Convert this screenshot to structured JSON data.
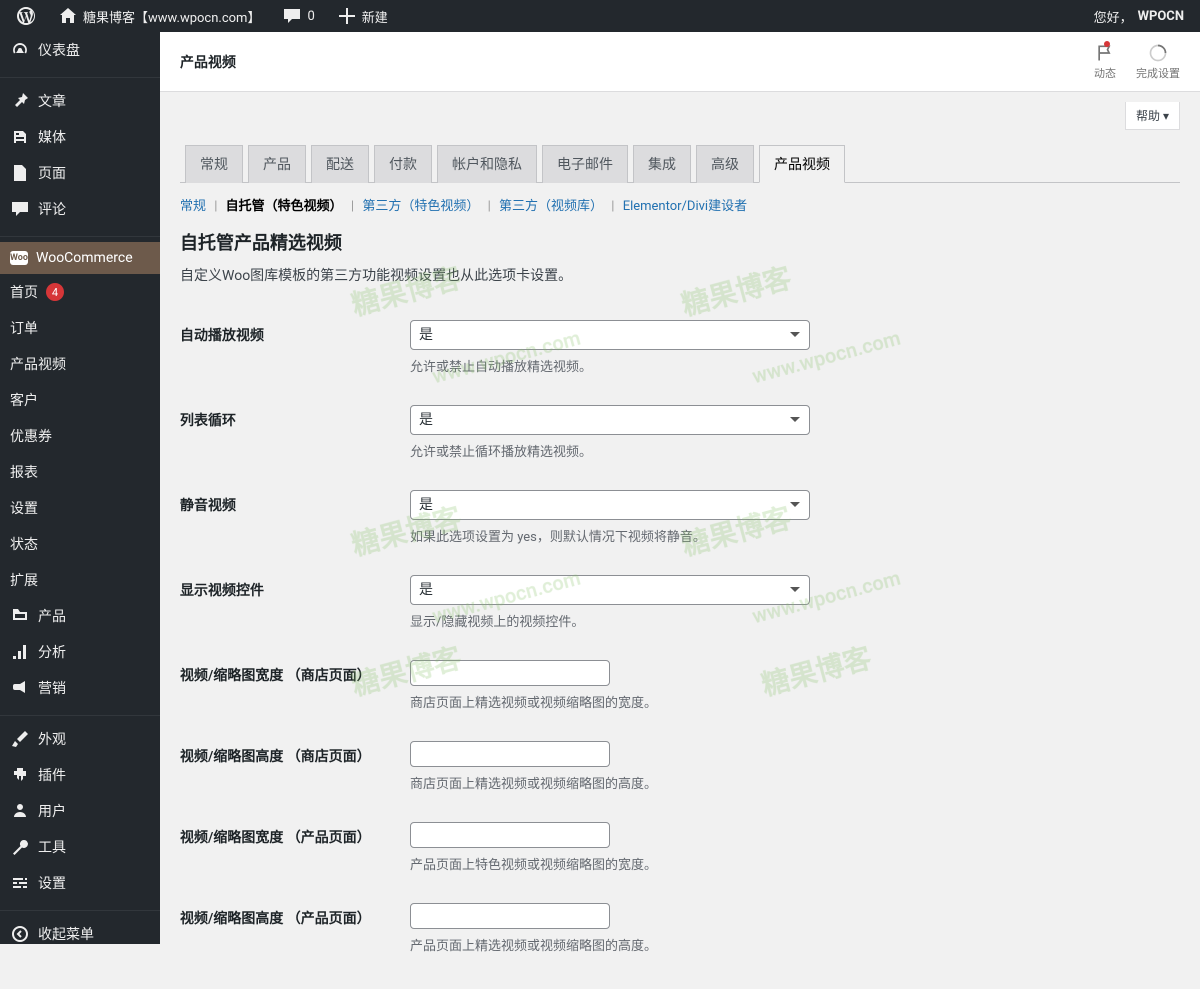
{
  "adminbar": {
    "site_name": "糖果博客【www.wpocn.com】",
    "comments_count": "0",
    "add_new": "新建",
    "howdy_prefix": "您好，",
    "username": "WPOCN"
  },
  "sidebar": {
    "items": [
      {
        "label": "仪表盘",
        "icon": "dashboard"
      },
      {
        "label": "文章",
        "icon": "post"
      },
      {
        "label": "媒体",
        "icon": "media"
      },
      {
        "label": "页面",
        "icon": "page"
      },
      {
        "label": "评论",
        "icon": "comment"
      },
      {
        "label": "WooCommerce",
        "icon": "woo",
        "current": true
      },
      {
        "label": "产品",
        "icon": "product"
      },
      {
        "label": "分析",
        "icon": "analytics"
      },
      {
        "label": "营销",
        "icon": "marketing"
      },
      {
        "label": "外观",
        "icon": "appearance"
      },
      {
        "label": "插件",
        "icon": "plugin"
      },
      {
        "label": "用户",
        "icon": "user"
      },
      {
        "label": "工具",
        "icon": "tool"
      },
      {
        "label": "设置",
        "icon": "settings"
      },
      {
        "label": "收起菜单",
        "icon": "collapse"
      }
    ],
    "woo_submenu": [
      {
        "label": "首页",
        "badge": "4"
      },
      {
        "label": "订单"
      },
      {
        "label": "产品视频"
      },
      {
        "label": "客户"
      },
      {
        "label": "优惠券"
      },
      {
        "label": "报表"
      },
      {
        "label": "设置",
        "current": true
      },
      {
        "label": "状态"
      },
      {
        "label": "扩展"
      }
    ]
  },
  "header": {
    "title": "产品视频",
    "activity": "动态",
    "finish_setup": "完成设置"
  },
  "help_label": "帮助",
  "tabs": [
    "常规",
    "产品",
    "配送",
    "付款",
    "帐户和隐私",
    "电子邮件",
    "集成",
    "高级",
    "产品视频"
  ],
  "active_tab_index": 8,
  "subtabs": {
    "general": "常规",
    "self_hosted": "自托管（特色视频）",
    "third_party_featured": "第三方（特色视频）",
    "third_party_library": "第三方（视频库）",
    "elementor": "Elementor/Divi建设者"
  },
  "section": {
    "title": "自托管产品精选视频",
    "description": "自定义Woo图库模板的第三方功能视频设置也从此选项卡设置。"
  },
  "fields": [
    {
      "label": "自动播放视频",
      "type": "select",
      "value": "是",
      "desc": "允许或禁止自动播放精选视频。"
    },
    {
      "label": "列表循环",
      "type": "select",
      "value": "是",
      "desc": "允许或禁止循环播放精选视频。"
    },
    {
      "label": "静音视频",
      "type": "select",
      "value": "是",
      "desc": "如果此选项设置为 yes，则默认情况下视频将静音。"
    },
    {
      "label": "显示视频控件",
      "type": "select",
      "value": "是",
      "desc": "显示/隐藏视频上的视频控件。"
    },
    {
      "label": "视频/缩略图宽度 （商店页面）",
      "type": "text",
      "value": "",
      "desc": "商店页面上精选视频或视频缩略图的宽度。"
    },
    {
      "label": "视频/缩略图高度 （商店页面）",
      "type": "text",
      "value": "",
      "desc": "商店页面上精选视频或视频缩略图的高度。"
    },
    {
      "label": "视频/缩略图宽度 （产品页面）",
      "type": "text",
      "value": "",
      "desc": "产品页面上特色视频或视频缩略图的宽度。"
    },
    {
      "label": "视频/缩略图高度 （产品页面）",
      "type": "text",
      "value": "",
      "desc": "产品页面上精选视频或视频缩略图的高度。"
    }
  ],
  "watermarks": {
    "text": "糖果博客",
    "url": "www.wpocn.com"
  }
}
